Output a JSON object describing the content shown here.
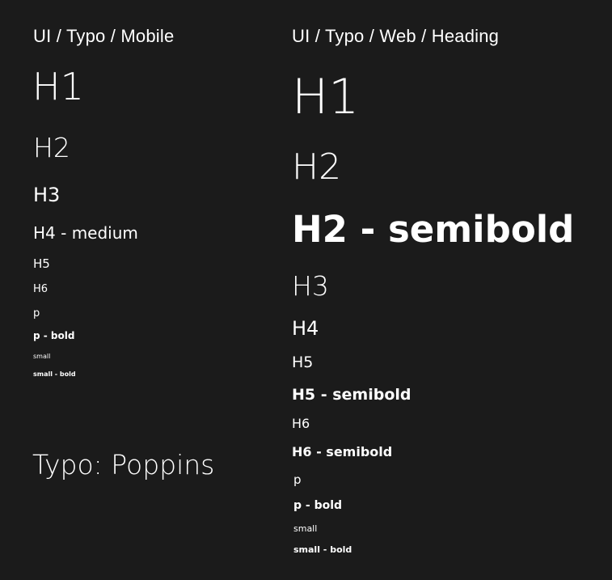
{
  "mobile": {
    "title": "UI / Typo / Mobile",
    "items": {
      "h1": "H1",
      "h2": "H2",
      "h3": "H3",
      "h4_medium": "H4 - medium",
      "h5": "H5",
      "h6": "H6",
      "p": "p",
      "p_bold": "p - bold",
      "small": "small",
      "small_bold": "small - bold"
    }
  },
  "font_note": "Typo: Poppins",
  "web": {
    "title": "UI / Typo / Web / Heading",
    "items": {
      "h1": "H1",
      "h2": "H2",
      "h2_semibold": "H2 - semibold",
      "h3": "H3",
      "h4": "H4",
      "h5": "H5",
      "h5_semibold": "H5 - semibold",
      "h6": "H6",
      "h6_semibold": "H6 - semibold",
      "p": "p",
      "p_bold": "p - bold",
      "small": "small",
      "small_bold": "small - bold"
    }
  },
  "colors": {
    "background": "#1b1b1b",
    "text": "#ffffff"
  }
}
